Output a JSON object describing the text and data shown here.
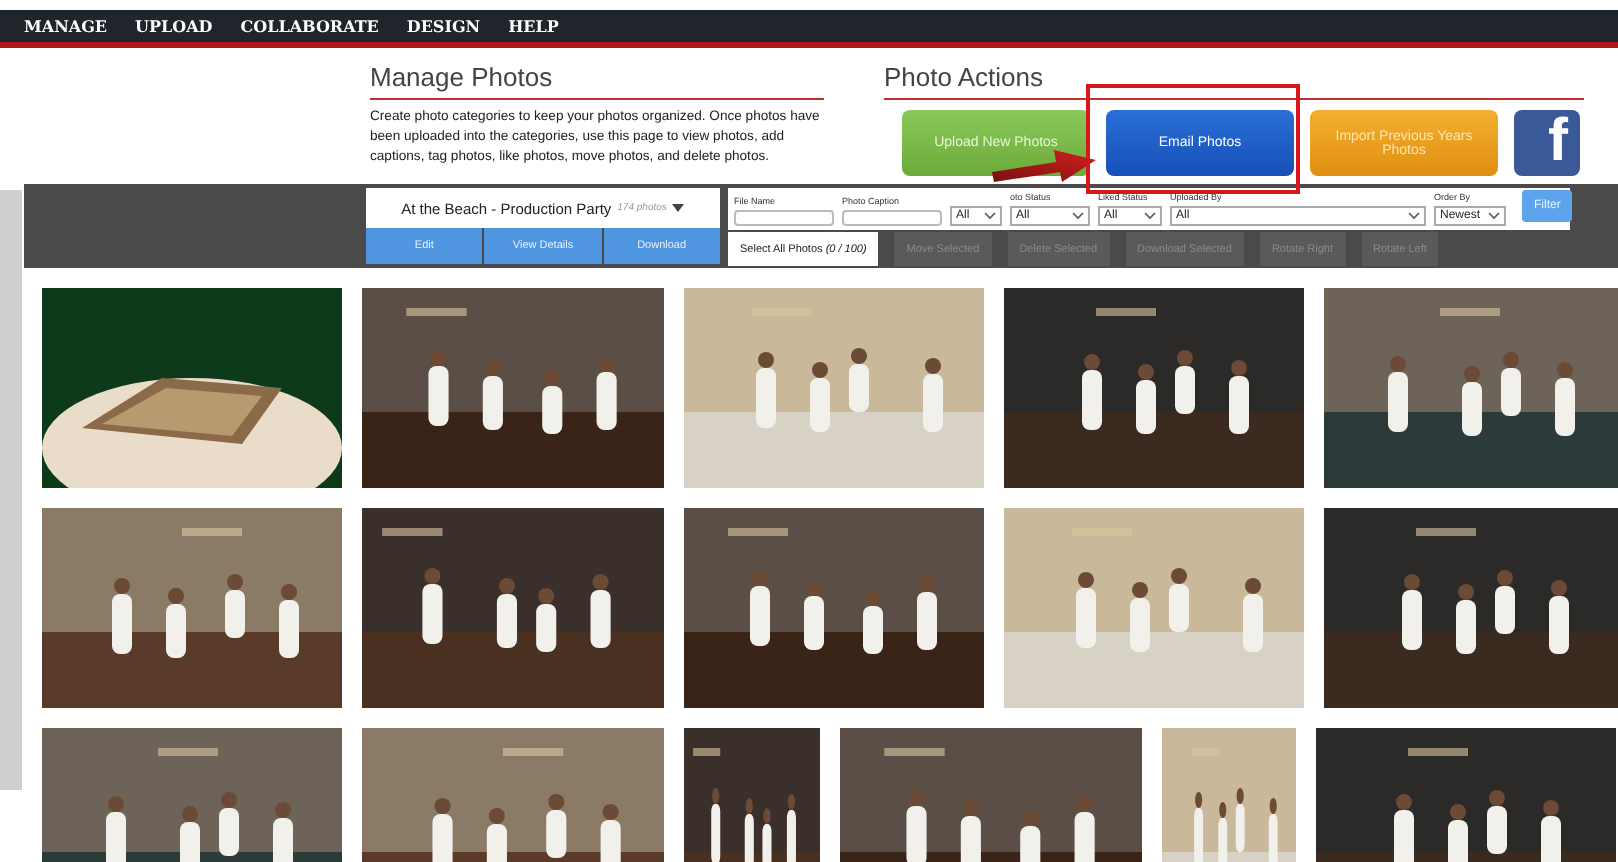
{
  "nav": [
    {
      "label": "MANAGE"
    },
    {
      "label": "UPLOAD"
    },
    {
      "label": "COLLABORATE"
    },
    {
      "label": "DESIGN"
    },
    {
      "label": "HELP"
    }
  ],
  "manage": {
    "title": "Manage Photos",
    "description": "Create photo categories to keep your photos organized. Once photos have been uploaded into the categories, use this page to view photos, add captions, tag photos, like photos, move photos, and delete photos."
  },
  "actions": {
    "title": "Photo Actions",
    "buttons": [
      {
        "label": "Upload New Photos",
        "kind": "green"
      },
      {
        "label": "Email Photos",
        "kind": "blue"
      },
      {
        "label": "Import Previous Years Photos",
        "kind": "orange"
      },
      {
        "label": "f",
        "kind": "facebook"
      }
    ]
  },
  "album": {
    "name": "At the Beach - Production Party",
    "count": "174 photos",
    "buttons": [
      "Edit",
      "View Details",
      "Download"
    ]
  },
  "filters": [
    {
      "label": "File Name",
      "kind": "text"
    },
    {
      "label": "Photo Caption",
      "kind": "text"
    },
    {
      "kind": "select",
      "value": "All"
    },
    {
      "label": "oto Status",
      "kind": "select",
      "value": "All"
    },
    {
      "label": "Liked Status",
      "kind": "select",
      "value": "All"
    },
    {
      "label": "Uploaded By",
      "kind": "select",
      "value": "All"
    },
    {
      "label": "Order By",
      "kind": "select",
      "value": "Newest"
    }
  ],
  "filter_button": "Filter",
  "bulk": [
    {
      "label": "Select All Photos *(0 / 100)*",
      "disabled": false
    },
    {
      "label": "Move Selected",
      "disabled": true
    },
    {
      "label": "Delete Selected",
      "disabled": true
    },
    {
      "label": "Download Selected",
      "disabled": true
    },
    {
      "label": "Rotate Right",
      "disabled": true
    },
    {
      "label": "Rotate Left",
      "disabled": true
    }
  ]
}
